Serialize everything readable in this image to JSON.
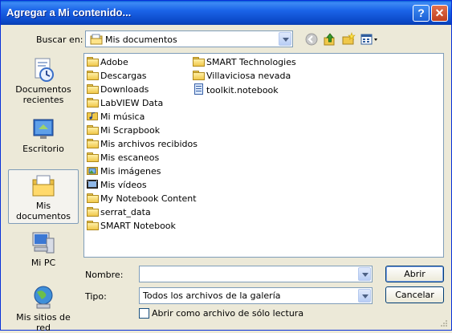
{
  "window": {
    "title": "Agregar a Mi contenido..."
  },
  "look_in": {
    "label": "Buscar en:",
    "value": "Mis documentos"
  },
  "places": [
    {
      "label": "Documentos recientes"
    },
    {
      "label": "Escritorio"
    },
    {
      "label": "Mis documentos"
    },
    {
      "label": "Mi PC"
    },
    {
      "label": "Mis sitios de red"
    }
  ],
  "files": {
    "col1": [
      "Adobe",
      "Descargas",
      "Downloads",
      "LabVIEW Data",
      "Mi música",
      "Mi Scrapbook",
      "Mis archivos recibidos",
      "Mis escaneos",
      "Mis imágenes",
      "Mis vídeos",
      "My Notebook Content",
      "serrat_data",
      "SMART Notebook"
    ],
    "col2": [
      "SMART Technologies",
      "Villaviciosa nevada",
      "toolkit.notebook"
    ]
  },
  "filename": {
    "label": "Nombre:",
    "value": ""
  },
  "filetype": {
    "label": "Tipo:",
    "value": "Todos los archivos de la galería"
  },
  "readonly": {
    "label": "Abrir como archivo de sólo lectura",
    "checked": false
  },
  "buttons": {
    "open": "Abrir",
    "cancel": "Cancelar"
  }
}
